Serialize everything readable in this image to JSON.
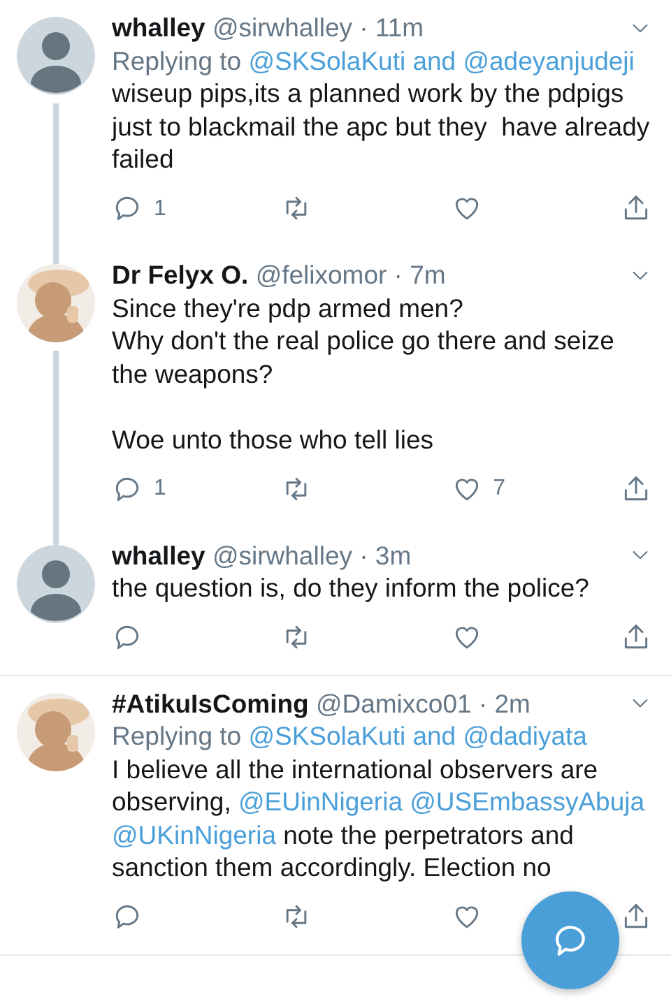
{
  "tweets": [
    {
      "name": "whalley",
      "handle": "@sirwhalley · 11m",
      "avatar": {
        "kind": "default"
      },
      "thread_above": false,
      "thread_below": true,
      "replying": {
        "prefix": "Replying to",
        "mentions": [
          {
            "text": "@SKSolaKuti"
          },
          {
            "text": "and"
          },
          {
            "text": "@adeyanjudeji"
          }
        ]
      },
      "body": [
        {
          "kind": "text",
          "text": "wiseup pips,its a planned work by the pdpigs just to blackmail the apc but they  have already failed"
        }
      ],
      "replies": "1"
    },
    {
      "name": "Dr Felyx O.",
      "handle": "@felixomor · 7m",
      "thread_above": true,
      "thread_below": true,
      "body": [
        {
          "kind": "text",
          "text": "Since they're pdp armed men?\nWhy don't the real police go there and seize the weapons?\n\nWoe unto those who tell lies"
        }
      ],
      "replies": "1",
      "likes": "7"
    },
    {
      "name": "whalley",
      "handle": "@sirwhalley · 3m",
      "avatar": {
        "kind": "default"
      },
      "thread_above": true,
      "thread_below": false,
      "body": [
        {
          "kind": "text",
          "text": "the question is, do they inform the police?"
        }
      ]
    },
    {
      "name": "#AtikuIsComing",
      "handle": "@Damixco01 · 2m",
      "thread_above": false,
      "thread_below": false,
      "replying": {
        "prefix": "Replying to",
        "mentions": [
          {
            "text": "@SKSolaKuti"
          },
          {
            "text": "and"
          },
          {
            "text": "@dadiyata"
          }
        ]
      },
      "body": [
        {
          "kind": "text",
          "text": "I believe all the international observers are observing, "
        },
        {
          "kind": "mention",
          "text": "@EUinNigeria"
        },
        {
          "kind": "mention",
          "text": "@USEmbassyAbuja"
        },
        {
          "kind": "mention",
          "text": "@UKinNigeria"
        },
        {
          "kind": "text",
          "text": " note the perpetrators and sanction them accordingly. Election no"
        }
      ]
    }
  ],
  "compose_button": {
    "visible": true
  }
}
